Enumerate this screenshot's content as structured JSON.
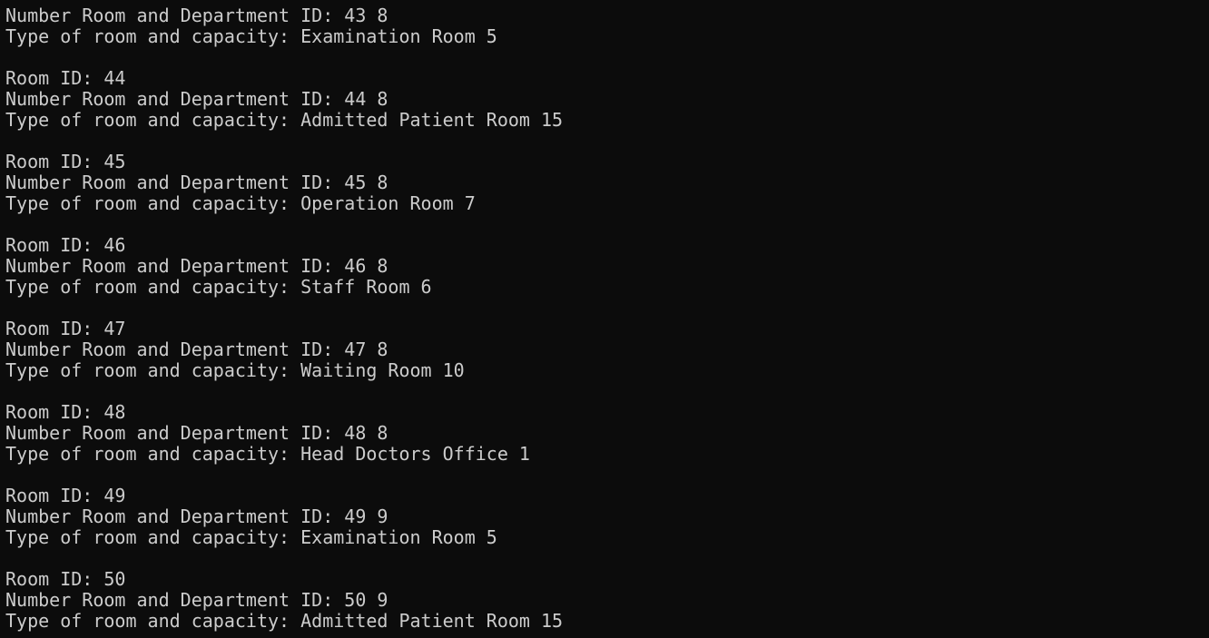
{
  "console": {
    "lines": [
      "Number Room and Department ID: 43 8",
      "Type of room and capacity: Examination Room 5",
      "",
      "Room ID: 44",
      "Number Room and Department ID: 44 8",
      "Type of room and capacity: Admitted Patient Room 15",
      "",
      "Room ID: 45",
      "Number Room and Department ID: 45 8",
      "Type of room and capacity: Operation Room 7",
      "",
      "Room ID: 46",
      "Number Room and Department ID: 46 8",
      "Type of room and capacity: Staff Room 6",
      "",
      "Room ID: 47",
      "Number Room and Department ID: 47 8",
      "Type of room and capacity: Waiting Room 10",
      "",
      "Room ID: 48",
      "Number Room and Department ID: 48 8",
      "Type of room and capacity: Head Doctors Office 1",
      "",
      "Room ID: 49",
      "Number Room and Department ID: 49 9",
      "Type of room and capacity: Examination Room 5",
      "",
      "Room ID: 50",
      "Number Room and Department ID: 50 9",
      "Type of room and capacity: Admitted Patient Room 15"
    ]
  },
  "colors": {
    "background": "#0c0c0c",
    "text": "#cccccc"
  }
}
